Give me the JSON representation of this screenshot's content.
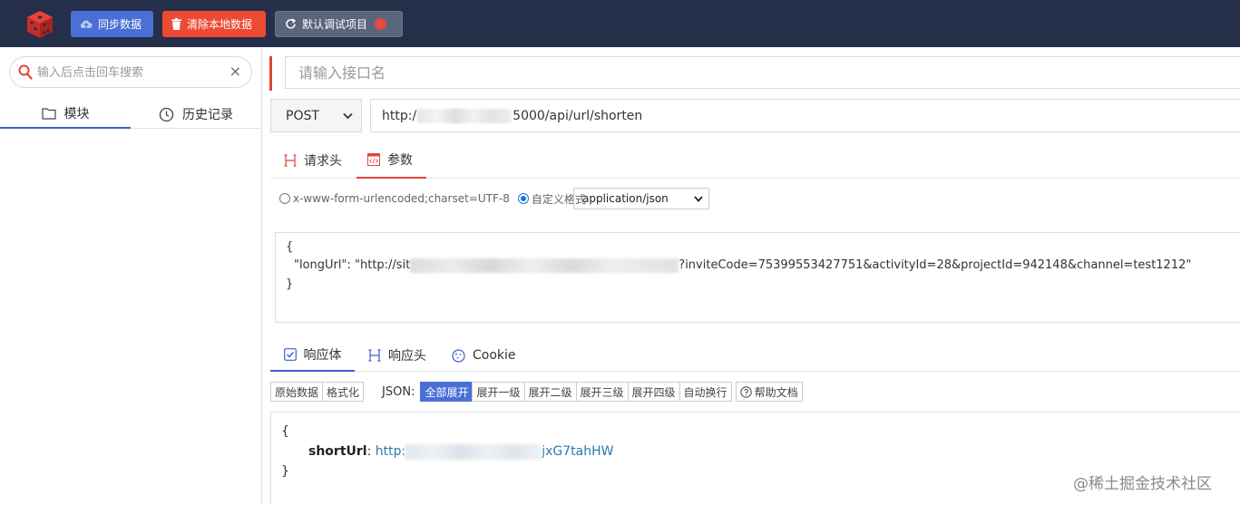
{
  "topbar": {
    "sync_label": "同步数据",
    "clear_label": "清除本地数据",
    "default_project_label": "默认调试项目"
  },
  "sidebar": {
    "search_placeholder": "输入后点击回车搜索",
    "clear_symbol": "×",
    "tabs": [
      {
        "label": "模块",
        "icon": "folder-icon",
        "active": true
      },
      {
        "label": "历史记录",
        "icon": "clock-icon",
        "active": false
      }
    ]
  },
  "request": {
    "name_placeholder": "请输入接口名",
    "method": "POST",
    "url_prefix": "http:/",
    "url_suffix": "5000/api/url/shorten",
    "tabs": [
      {
        "label": "请求头",
        "icon": "header-icon",
        "active": false
      },
      {
        "label": "参数",
        "icon": "code-icon",
        "active": true
      }
    ],
    "encoding_option_1": "x-www-form-urlencoded;charset=UTF-8",
    "encoding_option_2": "自定义格式",
    "selected_encoding": 2,
    "content_type": "application/json",
    "body_line_1": "{",
    "body_line_2_prefix": "\"longUrl\": \"http://sit",
    "body_line_2_suffix": "?inviteCode=75399553427751&activityId=28&projectId=942148&channel=test1212\"",
    "body_line_3": "}"
  },
  "response": {
    "tabs": [
      {
        "label": "响应体",
        "icon": "checkbox-icon",
        "active": true
      },
      {
        "label": "响应头",
        "icon": "header-icon",
        "active": false
      },
      {
        "label": "Cookie",
        "icon": "cookie-icon",
        "active": false
      }
    ],
    "raw_label": "原始数据",
    "format_label": "格式化",
    "json_label": "JSON:",
    "expand_all": "全部展开",
    "expand_1": "展开一级",
    "expand_2": "展开二级",
    "expand_3": "展开三级",
    "expand_4": "展开四级",
    "wrap": "自动换行",
    "help": "帮助文档",
    "open_brace": "{",
    "key": "shortUrl",
    "colon": ":",
    "value_prefix": "http:",
    "value_suffix": "jxG7tahHW",
    "close_brace": "}"
  },
  "watermark": "@稀土掘金技术社区",
  "colors": {
    "topbar_bg": "#252f4a",
    "sync_btn": "#4a6fd6",
    "clear_btn": "#ec4a35",
    "default_btn": "#5b6579",
    "accent_blue": "#3c5fcb",
    "accent_red": "#e0463a"
  }
}
